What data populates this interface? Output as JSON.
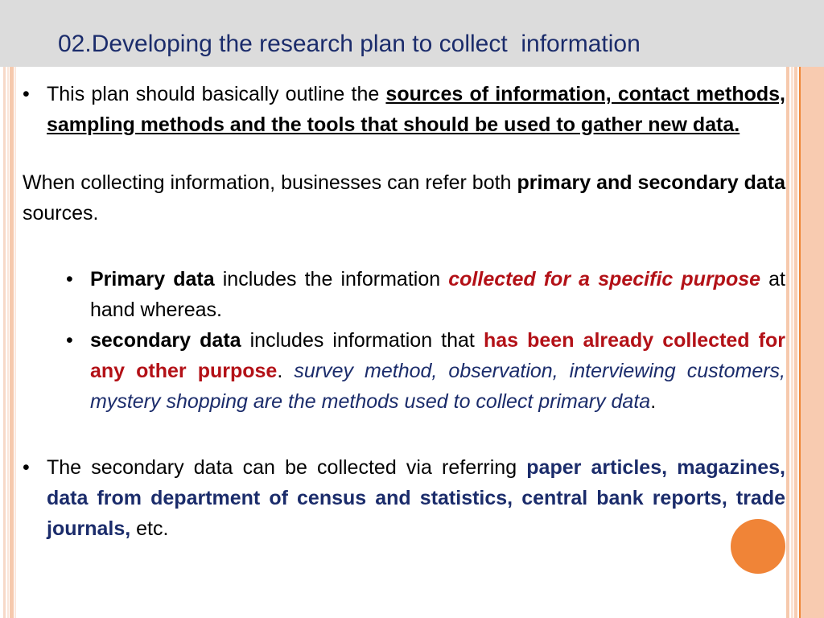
{
  "slide": {
    "title": "02.Developing the research plan to collect  information",
    "colors": {
      "title_navy": "#1b2c6b",
      "header_band": "#dcdcdc",
      "accent_orange": "#f08437",
      "emphasis_red": "#b31117",
      "stripe_peach": "#f6c9ad"
    },
    "bullet_glyph": "•"
  },
  "body": {
    "b1": {
      "lead": "This plan should basically outline the ",
      "emphasis": "sources of information, contact methods, sampling methods and the tools that should be used to gather new data."
    },
    "p2": {
      "part1": "When collecting information, businesses can refer both ",
      "bold1": "primary and secondary data",
      "part2": " sources."
    },
    "sub1": {
      "bold1": "Primary data",
      "mid1": " includes the information ",
      "red_italic": "collected for a specific purpose",
      "tail": " at hand whereas."
    },
    "sub2": {
      "bold1": "secondary data",
      "mid1": " includes information that ",
      "red_bold": "has been already collected for any other purpose",
      "dot": ". ",
      "navy_italic": "survey method, observation, interviewing customers, mystery shopping are the methods used to collect primary data",
      "end": "."
    },
    "b2": {
      "lead": "The secondary data can be collected via referring ",
      "navy_bold": "paper articles, magazines, data from department of census and statistics, central bank reports, trade journals,",
      "tail": " etc."
    }
  }
}
